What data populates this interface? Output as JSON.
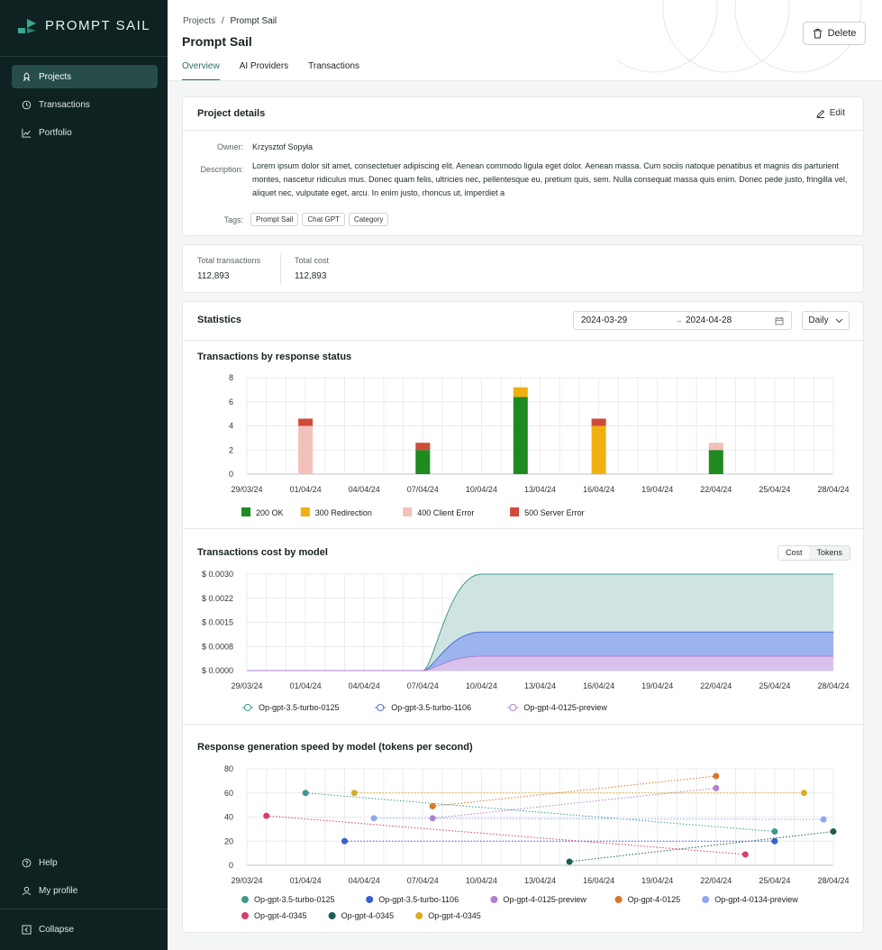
{
  "app": {
    "name": "PROMPT SAIL"
  },
  "sidebar": {
    "items": [
      {
        "label": "Projects",
        "icon": "rocket-icon",
        "active": true
      },
      {
        "label": "Transactions",
        "icon": "history-icon",
        "active": false
      },
      {
        "label": "Portfolio",
        "icon": "chart-line-icon",
        "active": false
      }
    ],
    "bottom": [
      {
        "label": "Help",
        "icon": "help-circle-icon"
      },
      {
        "label": "My profile",
        "icon": "user-icon"
      }
    ],
    "collapse_label": "Collapse"
  },
  "header": {
    "breadcrumb_root": "Projects",
    "breadcrumb_sep": "/",
    "breadcrumb_current": "Prompt Sail",
    "title": "Prompt Sail",
    "tabs": [
      "Overview",
      "AI Providers",
      "Transactions"
    ],
    "active_tab": "Overview",
    "delete_label": "Delete"
  },
  "project_details": {
    "title": "Project details",
    "edit_label": "Edit",
    "owner_label": "Owner:",
    "owner": "Krzysztof Sopyła",
    "description_label": "Description:",
    "description": "Lorem ipsum dolor sit amet, consectetuer adipiscing elit. Aenean commodo ligula eget dolor. Aenean massa. Cum sociis natoque penatibus et magnis dis parturient montes, nascetur ridiculus mus. Donec quam felis, ultricies nec, pellentesque eu, pretium quis, sem. Nulla consequat massa quis enim. Donec pede justo, fringilla vel, aliquet nec, vulputate eget, arcu. In enim justo, rhoncus ut, imperdiet a",
    "tags_label": "Tags:",
    "tags": [
      "Prompt Sail",
      "Chat GPT",
      "Category"
    ]
  },
  "totals": {
    "transactions_label": "Total transactions",
    "transactions_value": "112,893",
    "cost_label": "Total cost",
    "cost_value": "112,893"
  },
  "statistics": {
    "title": "Statistics",
    "date_from": "2024-03-29",
    "date_arrow": "→",
    "date_to": "2024-04-28",
    "granularity": "Daily",
    "cost_toggle": [
      "Cost",
      "Tokens"
    ]
  },
  "colors": {
    "accent": "#2b6f68",
    "sidebar_bg": "#0e2221",
    "ok": "#1f8a1f",
    "redirect": "#efb010",
    "client_error": "#f2c1bb",
    "server_error": "#cf4a3a"
  },
  "chart_data": [
    {
      "type": "bar",
      "title": "Transactions by response status",
      "stacked": true,
      "categories": [
        "29/03/24",
        "30/03/24",
        "31/03/24",
        "01/04/24",
        "02/04/24",
        "03/04/24",
        "04/04/24",
        "05/04/24",
        "06/04/24",
        "07/04/24",
        "08/04/24",
        "09/04/24",
        "10/04/24",
        "11/04/24",
        "12/04/24",
        "13/04/24",
        "14/04/24",
        "15/04/24",
        "16/04/24",
        "17/04/24",
        "18/04/24",
        "19/04/24",
        "20/04/24",
        "21/04/24",
        "22/04/24",
        "23/04/24",
        "24/04/24",
        "25/04/24",
        "26/04/24",
        "27/04/24",
        "28/04/24"
      ],
      "x_tick_labels": [
        "29/03/24",
        "01/04/24",
        "04/04/24",
        "07/04/24",
        "10/04/24",
        "13/04/24",
        "16/04/24",
        "19/04/24",
        "22/04/24",
        "25/04/24",
        "28/04/24"
      ],
      "series": [
        {
          "name": "200 OK",
          "color": "#1f8a1f",
          "values": [
            0,
            0,
            0,
            0,
            0,
            0,
            0,
            0,
            0,
            2,
            0,
            0,
            0,
            0,
            6.4,
            0,
            0,
            0,
            0,
            0,
            0,
            0,
            0,
            0,
            2,
            0,
            0,
            0,
            0,
            0,
            0
          ]
        },
        {
          "name": "300 Redirection",
          "color": "#efb010",
          "values": [
            0,
            0,
            0,
            0,
            0,
            0,
            0,
            0,
            0,
            0,
            0,
            0,
            0,
            0,
            0.8,
            0,
            0,
            0,
            4,
            0,
            0,
            0,
            0,
            0,
            0,
            0,
            0,
            0,
            0,
            0,
            0
          ]
        },
        {
          "name": "400 Client Error",
          "color": "#f2c1bb",
          "values": [
            0,
            0,
            0,
            4,
            0,
            0,
            0,
            0,
            0,
            0,
            0,
            0,
            0,
            0,
            0,
            0,
            0,
            0,
            0,
            0,
            0,
            0,
            0,
            0,
            0.6,
            0,
            0,
            0,
            0,
            0,
            0
          ]
        },
        {
          "name": "500 Server Error",
          "color": "#cf4a3a",
          "values": [
            0,
            0,
            0,
            0.6,
            0,
            0,
            0,
            0,
            0,
            0.6,
            0,
            0,
            0,
            0,
            0,
            0,
            0,
            0,
            0.6,
            0,
            0,
            0,
            0,
            0,
            0,
            0,
            0,
            0,
            0,
            0,
            0
          ]
        }
      ],
      "ylim": [
        0,
        8
      ],
      "yticks": [
        0,
        2,
        4,
        6,
        8
      ],
      "grid": true,
      "legend": "bottom-left"
    },
    {
      "type": "area",
      "title": "Transactions cost by model",
      "x_tick_labels": [
        "29/03/24",
        "01/04/24",
        "04/04/24",
        "07/04/24",
        "10/04/24",
        "13/04/24",
        "16/04/24",
        "19/04/24",
        "22/04/24",
        "25/04/24",
        "28/04/24"
      ],
      "x_range": [
        0,
        30
      ],
      "series": [
        {
          "name": "Op-gpt-3.5-turbo-0125",
          "color": "#3f9a8e",
          "x": [
            0,
            9,
            10.5,
            12,
            30
          ],
          "y": [
            0,
            0,
            0.002,
            0.003,
            0.003
          ]
        },
        {
          "name": "Op-gpt-3.5-turbo-1106",
          "color": "#4c6fd8",
          "x": [
            0,
            9,
            10.5,
            12,
            30
          ],
          "y": [
            0,
            0,
            0.0009,
            0.0012,
            0.0012
          ]
        },
        {
          "name": "Op-gpt-4-0125-preview",
          "color": "#b07fd0",
          "x": [
            0,
            9,
            10.5,
            12,
            30
          ],
          "y": [
            0,
            0,
            0.0003,
            0.00045,
            0.00045
          ]
        }
      ],
      "ylim": [
        0,
        0.003
      ],
      "ytick_labels": [
        "$ 0.0000",
        "$ 0.0008",
        "$ 0.0015",
        "$ 0.0022",
        "$ 0.0030"
      ],
      "grid": true,
      "legend": "bottom-left"
    },
    {
      "type": "scatter",
      "title": "Response generation speed by model (tokens per second)",
      "x_tick_labels": [
        "29/03/24",
        "01/04/24",
        "04/04/24",
        "07/04/24",
        "10/04/24",
        "13/04/24",
        "16/04/24",
        "19/04/24",
        "22/04/24",
        "25/04/24",
        "28/04/24"
      ],
      "x_range": [
        0,
        30
      ],
      "series": [
        {
          "name": "Op-gpt-3.5-turbo-0125",
          "color": "#3f9a8e",
          "points": [
            [
              3,
              60
            ],
            [
              27,
              28
            ]
          ]
        },
        {
          "name": "Op-gpt-3.5-turbo-1106",
          "color": "#3b5fd0",
          "points": [
            [
              5,
              20
            ],
            [
              27,
              20
            ]
          ]
        },
        {
          "name": "Op-gpt-4-0125-preview",
          "color": "#b07fd0",
          "points": [
            [
              9.5,
              39
            ],
            [
              24,
              64
            ]
          ]
        },
        {
          "name": "Op-gpt-4-0125",
          "color": "#d9772a",
          "points": [
            [
              9.5,
              49
            ],
            [
              24,
              74
            ]
          ]
        },
        {
          "name": "Op-gpt-4-0134-preview",
          "color": "#8fa8f0",
          "points": [
            [
              6.5,
              39
            ],
            [
              29.5,
              38
            ]
          ]
        },
        {
          "name": "Op-gpt-4-0345",
          "color": "#d23f6c",
          "points": [
            [
              1,
              41
            ],
            [
              25.5,
              9
            ]
          ]
        },
        {
          "name": "Op-gpt-4-0345",
          "color": "#1e5d55",
          "points": [
            [
              16.5,
              3
            ],
            [
              30,
              28
            ]
          ]
        },
        {
          "name": "Op-gpt-4-0345",
          "color": "#d9ad24",
          "points": [
            [
              5.5,
              60
            ],
            [
              28.5,
              60
            ]
          ]
        }
      ],
      "ylim": [
        0,
        80
      ],
      "yticks": [
        0,
        20,
        40,
        60,
        80
      ],
      "grid": true,
      "legend": "bottom-left"
    }
  ]
}
